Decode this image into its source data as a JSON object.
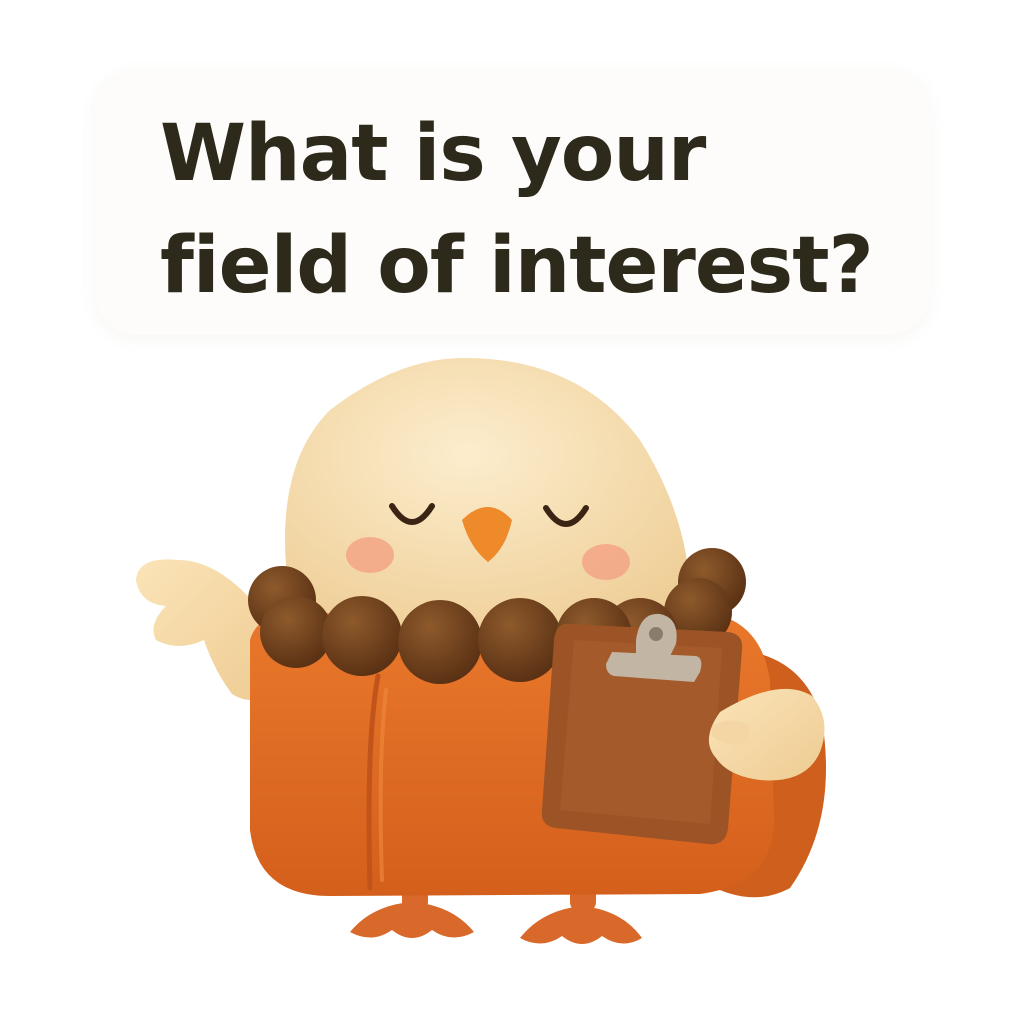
{
  "question": {
    "title": "What is your field of interest?"
  },
  "mascot": {
    "icon": "monk-chick-mascot-illustration",
    "colors": {
      "head": "#f7dfb2",
      "robe": "#e06c22",
      "beads": "#6e3f1b",
      "beak": "#ee8a2a",
      "clipboard": "#9c5427",
      "clip": "#c2b5a4",
      "cheek": "#f3a585"
    }
  }
}
